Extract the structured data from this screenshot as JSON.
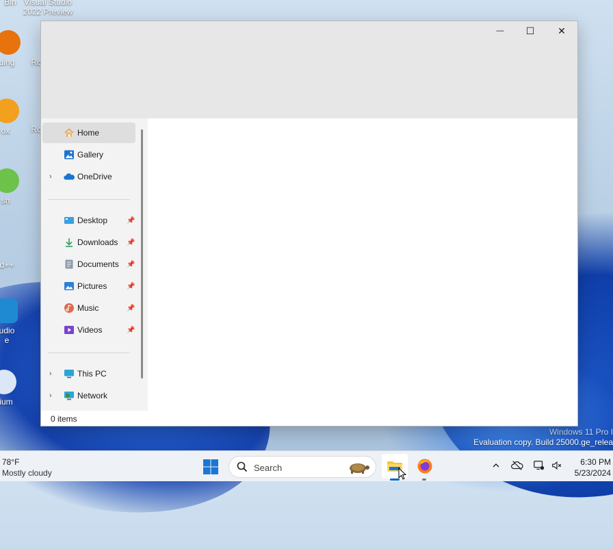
{
  "desktop": {
    "icons": [
      {
        "label": "Bin"
      },
      {
        "label": "Visual Studio 2022 Preview"
      },
      {
        "label": "uing"
      },
      {
        "label": "Roblo"
      },
      {
        "label": "ox"
      },
      {
        "label": "Roblo"
      },
      {
        "label": "sh"
      },
      {
        "label": "d++"
      },
      {
        "label": "udio\ne"
      },
      {
        "label": "ium"
      }
    ],
    "watermark_line1": "Windows 11 Pro I",
    "watermark_line2": "Evaluation copy. Build 25000.ge_relea"
  },
  "window": {
    "controls": {
      "minimize": "—",
      "maximize": "☐",
      "close": "✕"
    },
    "nav": {
      "quick": [
        {
          "label": "Home",
          "icon": "home-icon",
          "selected": true
        },
        {
          "label": "Gallery",
          "icon": "gallery-icon"
        },
        {
          "label": "OneDrive",
          "icon": "onedrive-icon",
          "expandable": true
        }
      ],
      "pinned": [
        {
          "label": "Desktop",
          "icon": "desktop-folder-icon"
        },
        {
          "label": "Downloads",
          "icon": "downloads-icon"
        },
        {
          "label": "Documents",
          "icon": "documents-icon"
        },
        {
          "label": "Pictures",
          "icon": "pictures-icon"
        },
        {
          "label": "Music",
          "icon": "music-icon"
        },
        {
          "label": "Videos",
          "icon": "videos-icon"
        }
      ],
      "devices": [
        {
          "label": "This PC",
          "icon": "this-pc-icon",
          "expandable": true
        },
        {
          "label": "Network",
          "icon": "network-icon",
          "expandable": true
        }
      ],
      "chevron": "›",
      "pin": "📌"
    },
    "status": "0 items"
  },
  "taskbar": {
    "weather": {
      "temp": "78°F",
      "desc": "Mostly cloudy"
    },
    "search_placeholder": "Search",
    "apps": [
      {
        "name": "File Explorer",
        "icon": "file-explorer-icon",
        "active": true
      },
      {
        "name": "Firefox",
        "icon": "firefox-icon"
      }
    ],
    "tray": {
      "chevron": "^"
    },
    "clock": {
      "time": "6:30 PM",
      "date": "5/23/2024"
    }
  },
  "colors": {
    "accent": "#0067c0",
    "titlebar": "#e7e7e7",
    "sidebar": "#f3f3f3"
  }
}
